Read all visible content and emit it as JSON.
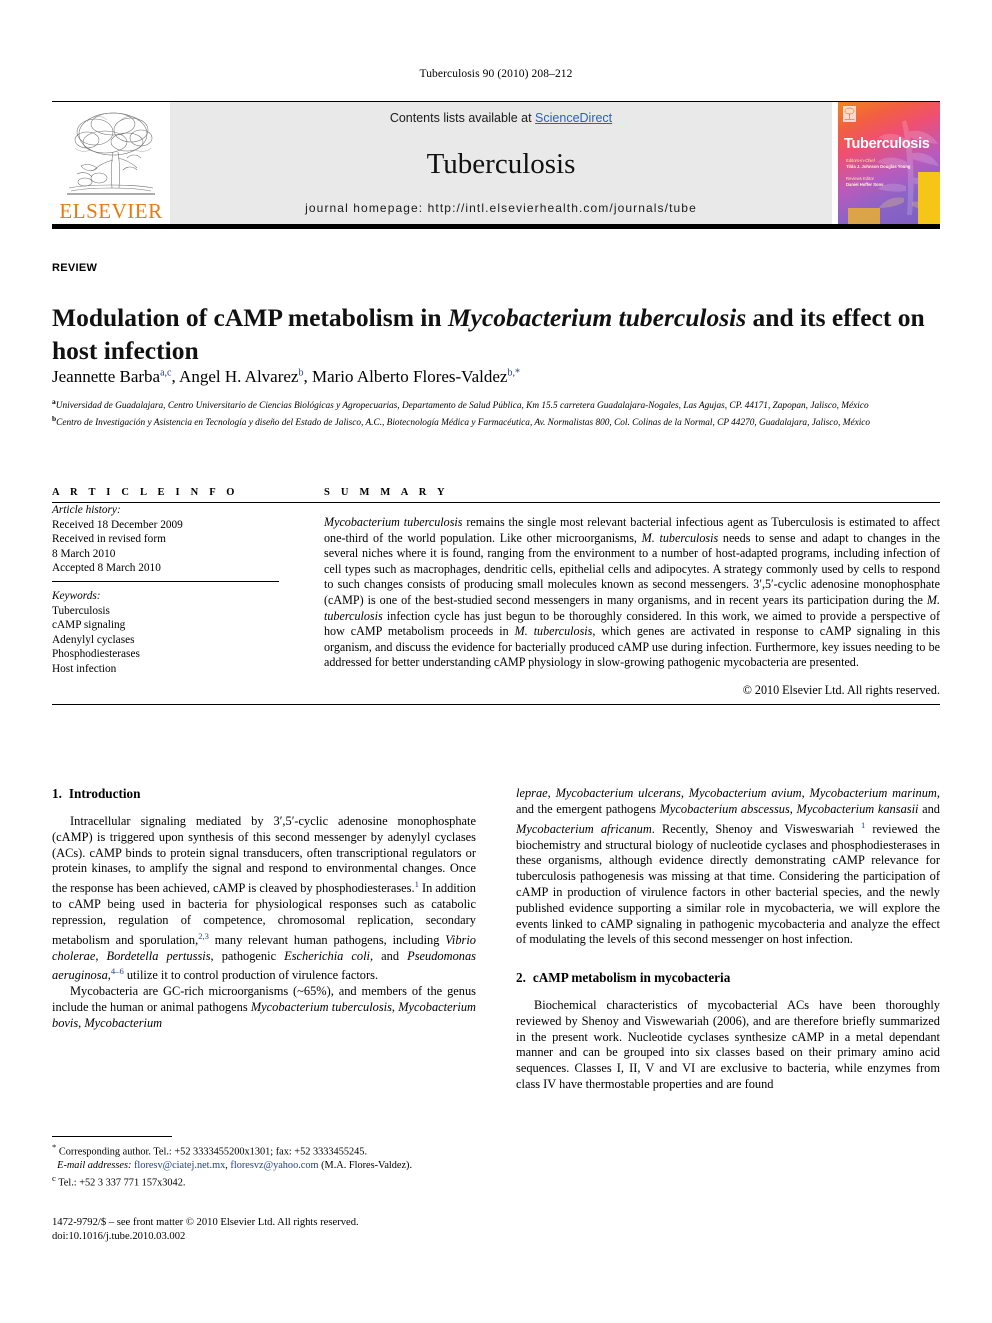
{
  "running_head": "Tuberculosis 90 (2010) 208–212",
  "masthead": {
    "contents_prefix": "Contents lists available at ",
    "sciencedirect": "ScienceDirect",
    "journal_name": "Tuberculosis",
    "homepage": "journal homepage: http://intl.elsevierhealth.com/journals/tube",
    "publisher_wordmark": "ELSEVIER",
    "publisher_color": "#E87B10",
    "link_color": "#2b5fc4",
    "cover": {
      "title": "Tuberculosis",
      "editor_label": "Editors-in-Chief",
      "editor_names": "Tilda J. Johnson\nDouglas Young",
      "assoc_label": "Reviews Editor",
      "assoc_names": "Daniel Hoffer Sons"
    }
  },
  "article": {
    "type": "REVIEW",
    "title_part1": "Modulation of cAMP metabolism in ",
    "title_italic": "Mycobacterium tuberculosis",
    "title_part2": " and its effect on host infection",
    "authors": [
      {
        "name": "Jeannette Barba",
        "sup": "a,c",
        "sep": ", "
      },
      {
        "name": "Angel H. Alvarez",
        "sup": "b",
        "sep": ", "
      },
      {
        "name": "Mario Alberto Flores-Valdez",
        "sup": "b,*",
        "sep": ""
      }
    ],
    "affiliations": [
      {
        "mark": "a",
        "text": "Universidad de Guadalajara, Centro Universitario de Ciencias Biológicas y Agropecuarias, Departamento de Salud Pública, Km 15.5 carretera Guadalajara-Nogales, Las Agujas, CP. 44171, Zapopan, Jalisco, México"
      },
      {
        "mark": "b",
        "text": "Centro de Investigación y Asistencia en Tecnología y diseño del Estado de Jalisco, A.C., Biotecnología Médica y Farmacéutica, Av. Normalistas 800, Col. Colinas de la Normal, CP 44270, Guadalajara, Jalisco, México"
      }
    ]
  },
  "info": {
    "heading": "A R T I C L E   I N F O",
    "history_label": "Article history:",
    "history": [
      "Received 18 December 2009",
      "Received in revised form",
      "8 March 2010",
      "Accepted 8 March 2010"
    ],
    "keywords_label": "Keywords:",
    "keywords": [
      "Tuberculosis",
      "cAMP signaling",
      "Adenylyl cyclases",
      "Phosphodiesterases",
      "Host infection"
    ]
  },
  "summary": {
    "heading": "S U M M A R Y",
    "copyright": "© 2010 Elsevier Ltd. All rights reserved."
  },
  "sections": {
    "intro": {
      "num": "1.",
      "title": "Introduction"
    },
    "camp": {
      "num": "2.",
      "title": "cAMP metabolism in mycobacteria"
    }
  },
  "footnotes": {
    "corresponding": "Corresponding author. Tel.: +52 3333455200x1301; fax: +52 3333455245.",
    "email_label": "E-mail addresses:",
    "email1": "floresv@ciatej.net.mx",
    "email2": "floresvz@yahoo.com",
    "email_tail": "(M.A. Flores-Valdez).",
    "tel_c_mark": "c",
    "tel_c": "Tel.: +52 3 337 771 157x3042."
  },
  "imprint": {
    "line1": "1472-9792/$ – see front matter © 2010 Elsevier Ltd. All rights reserved.",
    "line2": "doi:10.1016/j.tube.2010.03.002"
  }
}
